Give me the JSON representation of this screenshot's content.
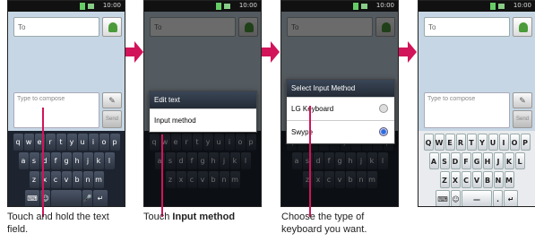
{
  "status_clock": "10:00",
  "to_placeholder": "To",
  "compose_placeholder": "Type to compose",
  "send_label": "Send",
  "keyboard_rows": [
    "qwertyuiop",
    "asdfghjkl",
    "zxcvbnm"
  ],
  "keyboard_rows_upper": [
    "QWERTYUIOP",
    "ASDFGHJKL",
    "ZXCVBNM"
  ],
  "menu_edit_text": {
    "title": "Edit text",
    "item": "Input method"
  },
  "menu_select_input": {
    "title": "Select Input Method",
    "options": [
      {
        "label": "LG Keyboard",
        "selected": false
      },
      {
        "label": "Swype",
        "selected": true
      }
    ]
  },
  "captions": {
    "step1": "Touch and hold the text field.",
    "step2_prefix": "Touch ",
    "step2_bold": "Input method",
    "step3": "Choose the type of keyboard you want."
  },
  "colors": {
    "arrow": "#d2145a",
    "pointer": "#d2145a"
  }
}
